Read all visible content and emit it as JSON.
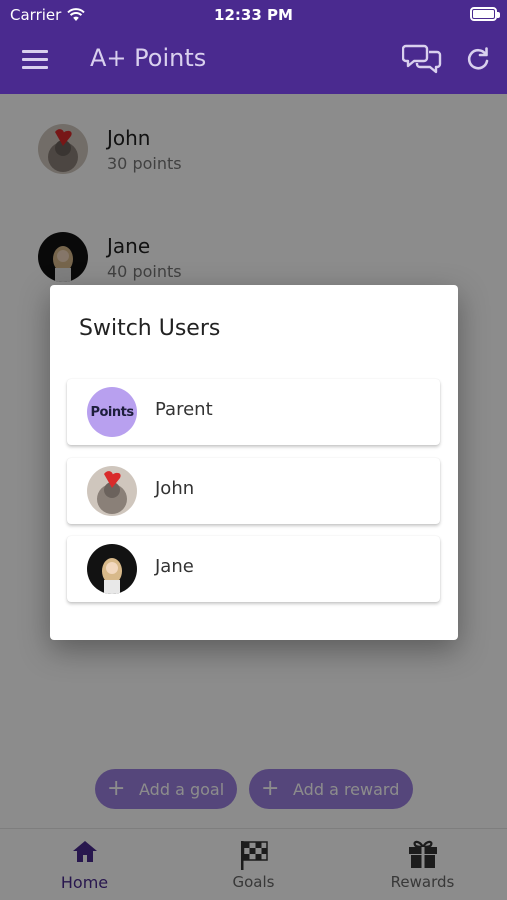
{
  "status": {
    "carrier": "Carrier",
    "time": "12:33 PM"
  },
  "app": {
    "title": "A+ Points"
  },
  "icons": {
    "menu": "menu-icon",
    "chat": "chat-bubbles-icon",
    "refresh": "refresh-icon",
    "home": "home-icon",
    "goals": "checkered-flag-icon",
    "rewards": "gift-icon"
  },
  "colors": {
    "brand": "#4a2a8f",
    "accent": "#9c80e0",
    "logo_bg": "#b8a0ef"
  },
  "users": [
    {
      "name": "John",
      "points": "30 points"
    },
    {
      "name": "Jane",
      "points": "40 points"
    }
  ],
  "actions": {
    "add_goal": "Add a goal",
    "add_reward": "Add a reward"
  },
  "tabs": [
    {
      "label": "Home",
      "active": true
    },
    {
      "label": "Goals",
      "active": false
    },
    {
      "label": "Rewards",
      "active": false
    }
  ],
  "dialog": {
    "title": "Switch Users",
    "options": [
      {
        "label": "Parent",
        "logo_text": "Points"
      },
      {
        "label": "John"
      },
      {
        "label": "Jane"
      }
    ]
  }
}
